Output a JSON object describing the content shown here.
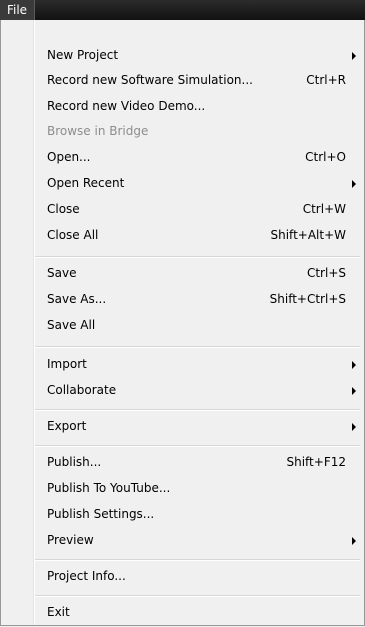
{
  "menubar": {
    "file_label": "File"
  },
  "menu": {
    "new_project": "New Project",
    "record_sim": "Record new Software Simulation...",
    "record_sim_shortcut": "Ctrl+R",
    "record_video": "Record new Video Demo...",
    "browse_bridge": "Browse in Bridge",
    "open": "Open...",
    "open_shortcut": "Ctrl+O",
    "open_recent": "Open Recent",
    "close": "Close",
    "close_shortcut": "Ctrl+W",
    "close_all": "Close All",
    "close_all_shortcut": "Shift+Alt+W",
    "save": "Save",
    "save_shortcut": "Ctrl+S",
    "save_as": "Save As...",
    "save_as_shortcut": "Shift+Ctrl+S",
    "save_all": "Save All",
    "import": "Import",
    "collaborate": "Collaborate",
    "export": "Export",
    "publish": "Publish...",
    "publish_shortcut": "Shift+F12",
    "publish_youtube": "Publish To YouTube...",
    "publish_settings": "Publish Settings...",
    "preview": "Preview",
    "project_info": "Project Info...",
    "exit": "Exit"
  }
}
